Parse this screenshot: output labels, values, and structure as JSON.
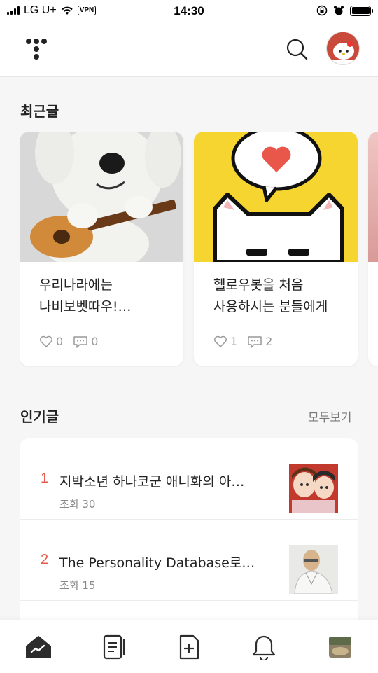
{
  "status_bar": {
    "carrier": "LG U+",
    "vpn": "VPN",
    "time": "14:30"
  },
  "header": {
    "logo_icon": "tistory-logo",
    "search_icon": "search-icon",
    "avatar": "hello-kitty-avatar"
  },
  "recent": {
    "title": "최근글",
    "posts": [
      {
        "title": "우리나라에는  나비보벳따우! 외국에는...",
        "likes": "0",
        "comments": "0",
        "image": "dog-with-guitar"
      },
      {
        "title": "헬로우봇을 처음 사용하시는 분들에게",
        "likes": "1",
        "comments": "2",
        "image": "white-cat-with-heart"
      }
    ]
  },
  "popular": {
    "title": "인기글",
    "see_all": "모두보기",
    "items": [
      {
        "rank": "1",
        "title": "지박소년 하나코군 애니화의 아…",
        "views": "조회 30"
      },
      {
        "rank": "2",
        "title": "The Personality Database로…",
        "views": "조회 15"
      }
    ]
  },
  "tabbar": {
    "tabs": [
      "home-chart-icon",
      "document-list-icon",
      "add-post-icon",
      "bell-icon",
      "profile-thumbnail"
    ]
  },
  "colors": {
    "accent": "#e55b4a",
    "background": "#f6f6f6",
    "card": "#ffffff"
  }
}
